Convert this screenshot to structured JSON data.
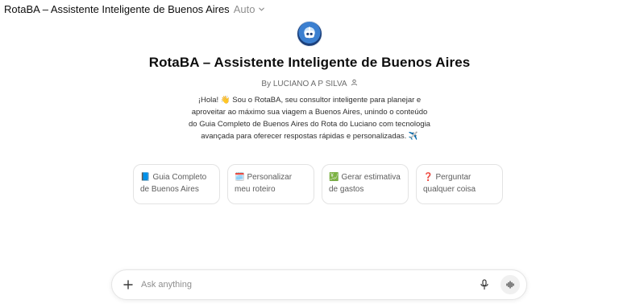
{
  "header": {
    "gpt_name": "RotaBA – Assistente Inteligente de Buenos Aires",
    "model_label": "Auto"
  },
  "profile": {
    "title": "RotaBA – Assistente Inteligente de Buenos Aires",
    "byline": "By LUCIANO A P SILVA",
    "description": "¡Hola! 👋 Sou o RotaBA, seu consultor inteligente para planejar e aproveitar ao máximo sua viagem a Buenos Aires, unindo o conteúdo do Guia Completo de Buenos Aires do Rota do Luciano com tecnologia avançada para oferecer respostas rápidas e personalizadas. ✈️"
  },
  "starters": [
    {
      "emoji": "📘",
      "label": "Guia Completo de Buenos Aires"
    },
    {
      "emoji": "🗓️",
      "label": "Personalizar meu roteiro"
    },
    {
      "emoji": "💹",
      "label": "Gerar estimativa de gastos"
    },
    {
      "emoji": "❓",
      "label": "Perguntar qualquer coisa"
    }
  ],
  "composer": {
    "placeholder": "Ask anything"
  }
}
